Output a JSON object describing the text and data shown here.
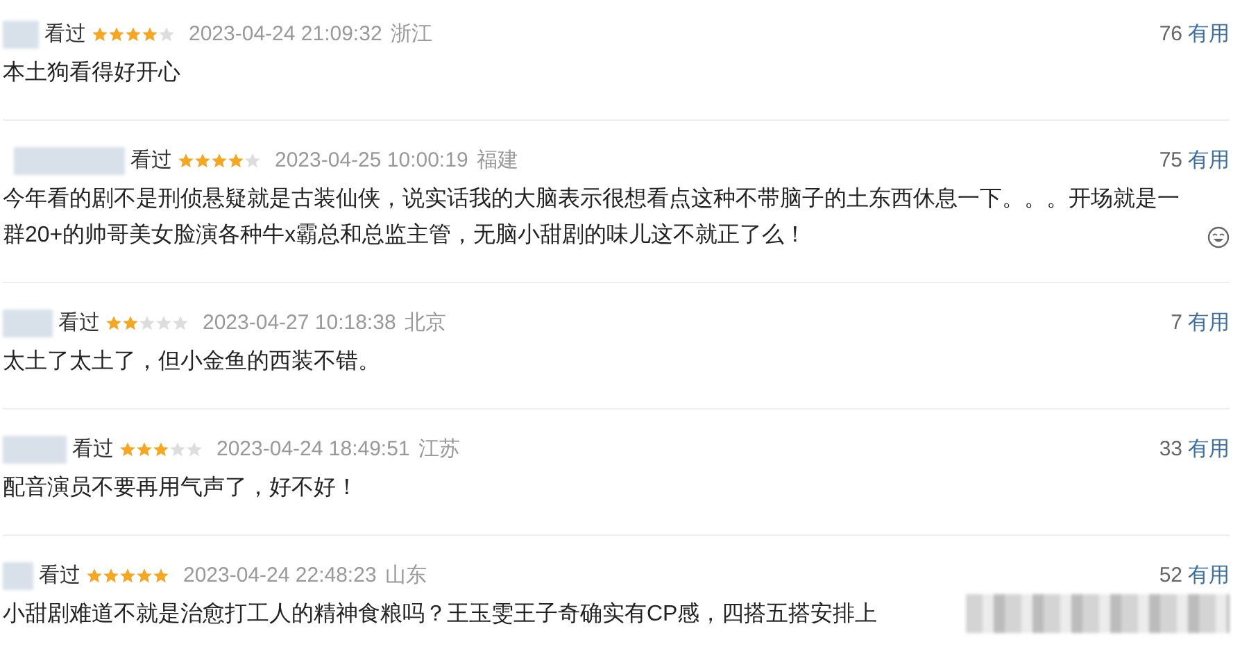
{
  "comments": [
    {
      "status": "看过",
      "stars": 4,
      "time": "2023-04-24 21:09:32",
      "location": "浙江",
      "votes": "76",
      "vote_label": "有用",
      "text": "本土狗看得好开心",
      "emoticon": false,
      "redacted_tail": false
    },
    {
      "status": "看过",
      "stars": 4,
      "time": "2023-04-25 10:00:19",
      "location": "福建",
      "votes": "75",
      "vote_label": "有用",
      "text": "今年看的剧不是刑侦悬疑就是古装仙侠，说实话我的大脑表示很想看点这种不带脑子的土东西休息一下。。。开场就是一群20+的帅哥美女脸演各种牛x霸总和总监主管，无脑小甜剧的味儿这不就正了么！",
      "emoticon": true,
      "redacted_tail": false
    },
    {
      "status": "看过",
      "stars": 2,
      "time": "2023-04-27 10:18:38",
      "location": "北京",
      "votes": "7",
      "vote_label": "有用",
      "text": "太土了太土了，但小金鱼的西装不错。",
      "emoticon": false,
      "redacted_tail": false
    },
    {
      "status": "看过",
      "stars": 3,
      "time": "2023-04-24 18:49:51",
      "location": "江苏",
      "votes": "33",
      "vote_label": "有用",
      "text": "配音演员不要再用气声了，好不好！",
      "emoticon": false,
      "redacted_tail": false
    },
    {
      "status": "看过",
      "stars": 5,
      "time": "2023-04-24 22:48:23",
      "location": "山东",
      "votes": "52",
      "vote_label": "有用",
      "text": "小甜剧难道不就是治愈打工人的精神食粮吗？王玉雯王子奇确实有CP感，四搭五搭安排上",
      "emoticon": false,
      "redacted_tail": true
    }
  ]
}
